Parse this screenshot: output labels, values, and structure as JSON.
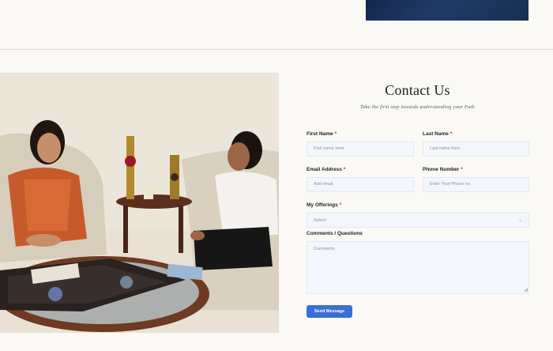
{
  "header": {},
  "contact": {
    "title": "Contact Us",
    "subtitle": "Take the first step towards understanding your Path",
    "first_name": {
      "label": "First Name",
      "required": "*",
      "placeholder": "First name here"
    },
    "last_name": {
      "label": "Last Name",
      "required": "*",
      "placeholder": "Last name here"
    },
    "email": {
      "label": "Email Address",
      "required": "*",
      "placeholder": "Add email"
    },
    "phone": {
      "label": "Phone Number",
      "required": "*",
      "placeholder": "Enter Your Phone no."
    },
    "offerings": {
      "label": "My Offerings",
      "required": "*",
      "selected": "Select"
    },
    "comments": {
      "label": "Comments / Questions",
      "placeholder": "Comments"
    },
    "submit_label": "Send Message"
  },
  "colors": {
    "accent": "#3b6fd8",
    "required": "#d0192b",
    "background": "#faf9f5"
  }
}
